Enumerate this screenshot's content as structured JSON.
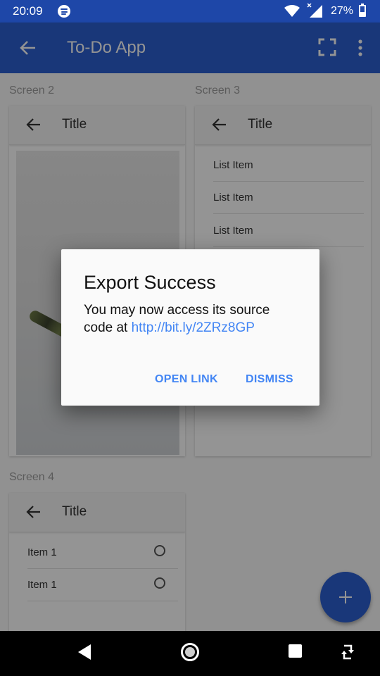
{
  "status_bar": {
    "time": "20:09",
    "battery": "27%"
  },
  "app_bar": {
    "title": "To-Do App"
  },
  "screens": {
    "screen2": {
      "label": "Screen 2",
      "title": "Title"
    },
    "screen3": {
      "label": "Screen 3",
      "title": "Title",
      "items": [
        "List Item",
        "List Item",
        "List Item"
      ]
    },
    "screen4": {
      "label": "Screen 4",
      "title": "Title",
      "items": [
        "Item 1",
        "Item 1"
      ]
    }
  },
  "dialog": {
    "title": "Export Success",
    "body": "You may now access its source code at",
    "link": "http://bit.ly/2ZRz8GP",
    "open_label": "OPEN LINK",
    "dismiss_label": "DISMISS"
  },
  "colors": {
    "primary": "#2c5fd0",
    "status": "#1e47a8",
    "accent": "#4285f4"
  }
}
